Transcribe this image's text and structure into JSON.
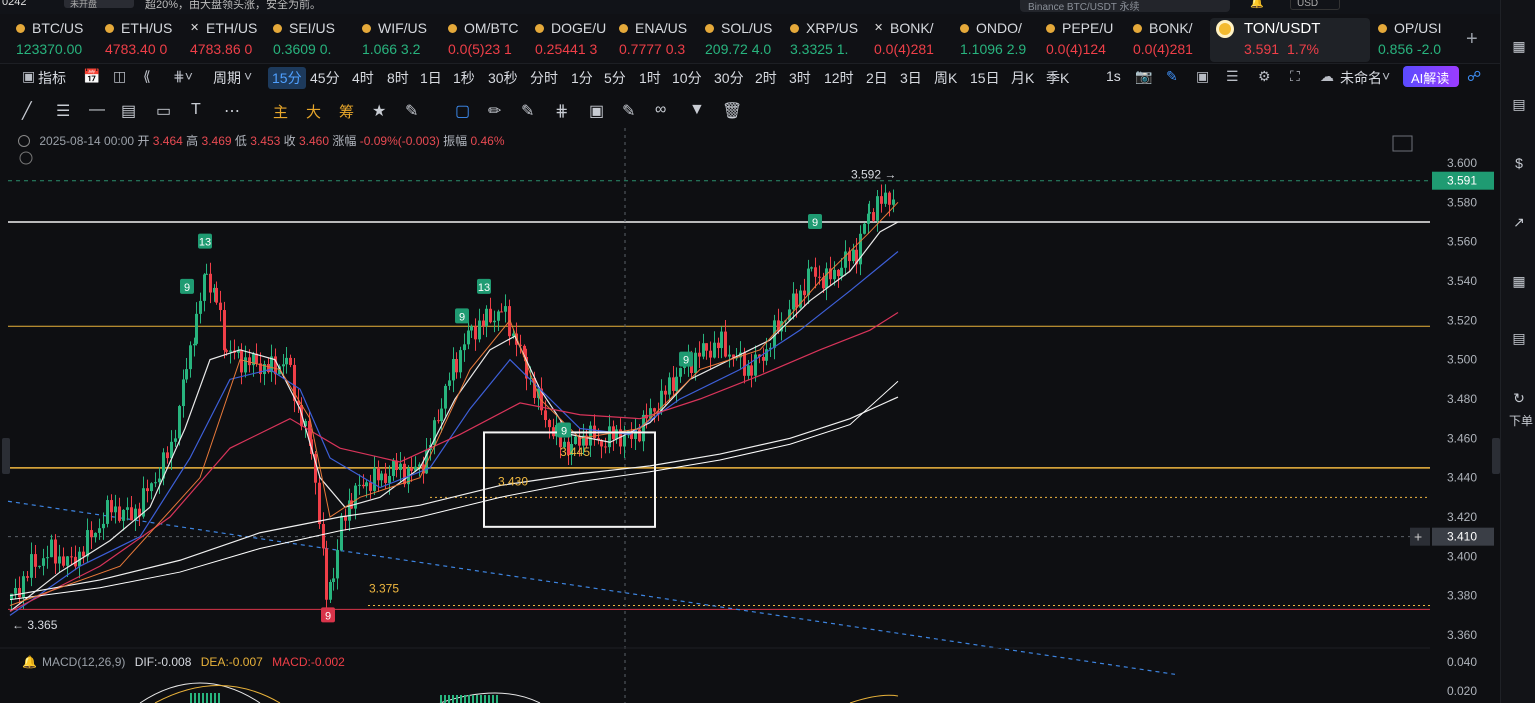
{
  "topbar": {
    "code": "0242",
    "pill": "未开盘",
    "notice": "超20%，由大盘领头涨，安全为前。",
    "search_placeholder": "Binance BTC/USDT 永续",
    "currency": "USD"
  },
  "tickers": [
    {
      "symbol": "BTC/US",
      "price": "123370.00",
      "dir": "up",
      "icon": "btc-coin-icon"
    },
    {
      "symbol": "ETH/US",
      "price": "4783.40 0",
      "dir": "down",
      "icon": "eth-coin-icon"
    },
    {
      "symbol": "ETH/US",
      "price": "4783.86 0",
      "dir": "down",
      "icon": "x-exchange-icon"
    },
    {
      "symbol": "SEI/US",
      "price": "0.3609 0.",
      "dir": "up",
      "icon": "sei-coin-icon"
    },
    {
      "symbol": "WIF/US",
      "price": "1.066 3.2",
      "dir": "up",
      "icon": "wif-coin-icon"
    },
    {
      "symbol": "OM/BTC",
      "price": "0.0(5)23 1",
      "dir": "down",
      "icon": "om-coin-icon"
    },
    {
      "symbol": "DOGE/U",
      "price": "0.25441 3",
      "dir": "down",
      "icon": "doge-coin-icon"
    },
    {
      "symbol": "ENA/US",
      "price": "0.7777 0.3",
      "dir": "down",
      "icon": "ena-coin-icon"
    },
    {
      "symbol": "SOL/US",
      "price": "209.72 4.0",
      "dir": "up",
      "icon": "sol-coin-icon"
    },
    {
      "symbol": "XRP/US",
      "price": "3.3325 1.",
      "dir": "up",
      "icon": "xrp-coin-icon"
    },
    {
      "symbol": "BONK/",
      "price": "0.0(4)281",
      "dir": "down",
      "icon": "x-exchange-icon"
    },
    {
      "symbol": "ONDO/",
      "price": "1.1096 2.9",
      "dir": "up",
      "icon": "ondo-coin-icon"
    },
    {
      "symbol": "PEPE/U",
      "price": "0.0(4)124",
      "dir": "down",
      "icon": "pepe-coin-icon"
    },
    {
      "symbol": "BONK/",
      "price": "0.0(4)281",
      "dir": "down",
      "icon": "bonk-coin-icon"
    },
    {
      "symbol": "TON/USDT",
      "price": "3.591",
      "change": "1.7%",
      "dir": "down",
      "icon": "ton-coin-icon",
      "active": true
    },
    {
      "symbol": "OP/USI",
      "price": "0.856 -2.0",
      "dir": "up",
      "icon": "op-coin-icon"
    }
  ],
  "toolbar": {
    "indicators": "指标",
    "period": "周期",
    "intervals": [
      "15分",
      "45分",
      "4时",
      "8时",
      "1日",
      "1秒",
      "30秒",
      "分时",
      "1分",
      "5分",
      "1时",
      "10分",
      "30分",
      "2时",
      "3时",
      "12时",
      "2日",
      "3日",
      "周K",
      "15日",
      "月K",
      "季K"
    ],
    "selected_interval": "15分",
    "seconds": "1s",
    "unnamed": "未命名",
    "ai": "AI解读"
  },
  "draw_tools": {
    "labels": [
      "主",
      "大",
      "筹"
    ]
  },
  "ohlc": {
    "date": "2025-08-14 00:00",
    "open_label": "开",
    "open": "3.464",
    "high_label": "高",
    "high": "3.469",
    "low_label": "低",
    "low": "3.453",
    "close_label": "收",
    "close": "3.460",
    "change_label": "涨幅",
    "change": "-0.09%(-0.003)",
    "amp_label": "振幅",
    "amp": "0.46%"
  },
  "annotations": {
    "high_marker": "3.592 →",
    "low_marker": "← 3.365",
    "level_a": "3.445",
    "level_b": "3.430",
    "level_c": "3.375",
    "seq_labels": [
      "13",
      "9",
      "9",
      "13",
      "9",
      "9",
      "9",
      "9"
    ]
  },
  "price_axis": {
    "ticks": [
      "3.600",
      "3.580",
      "3.560",
      "3.540",
      "3.520",
      "3.500",
      "3.480",
      "3.460",
      "3.440",
      "3.420",
      "3.400",
      "3.380",
      "3.360"
    ],
    "current_price": "3.591",
    "crosshair_price": "3.410",
    "macd_ticks": [
      "0.040",
      "0.020"
    ]
  },
  "macd": {
    "name": "MACD(12,26,9)",
    "dif": "DIF:-0.008",
    "dea": "DEA:-0.007",
    "macd": "MACD:-0.002"
  },
  "sidebar": {
    "order_label": "下单"
  },
  "colors": {
    "up": "#28b47e",
    "down": "#ef3f48",
    "accent": "#3f8ff5",
    "yellow": "#e8b23a"
  }
}
